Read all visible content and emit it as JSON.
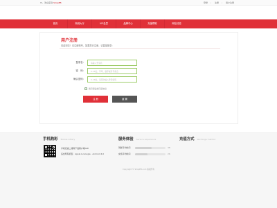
{
  "topbar": {
    "greeting": "Hi，欢迎来到",
    "site_link": "ShopEB",
    "links": [
      "登录",
      "注册",
      "用户注册"
    ]
  },
  "nav": {
    "items": [
      "首页",
      "商城大厅",
      "VIP会员",
      "品牌中心",
      "充值帮助",
      "网站动态"
    ]
  },
  "register": {
    "title": "用户注册",
    "subtitle": "欢迎到访！请注册账号，如果您已注册，请直接登录：",
    "fields": [
      {
        "label": "登录名：",
        "placeholder": "请输入登录名"
      },
      {
        "label": "密　码：",
        "placeholder": "6-16位，字母、数字或符号组合"
      },
      {
        "label": "确认密码：",
        "placeholder": "6-16位，请再次输入登录密码"
      }
    ],
    "agree_text": "我已阅读并同意协议",
    "submit_label": "注 册",
    "reset_label": "重 置"
  },
  "footer": {
    "mobile": {
      "title": "手机购彩",
      "title_en": "Mobile lottery",
      "lines": [
        "手机扫描二维码下载客户端APP",
        "适合所有机型 · Apple & Google · Android 4.0"
      ]
    },
    "service": {
      "title": "服务体验",
      "title_en": "Service experience",
      "items": [
        {
          "label": "到账平均时间",
          "value": "38",
          "fill": 0.55
        },
        {
          "label": "充值平均时间",
          "value": "26",
          "fill": 0.4
        }
      ]
    },
    "payment": {
      "title": "充值方式",
      "title_en": "Recharge method"
    },
    "copyright": "Copyright © ShopEB.com 版权所有"
  }
}
